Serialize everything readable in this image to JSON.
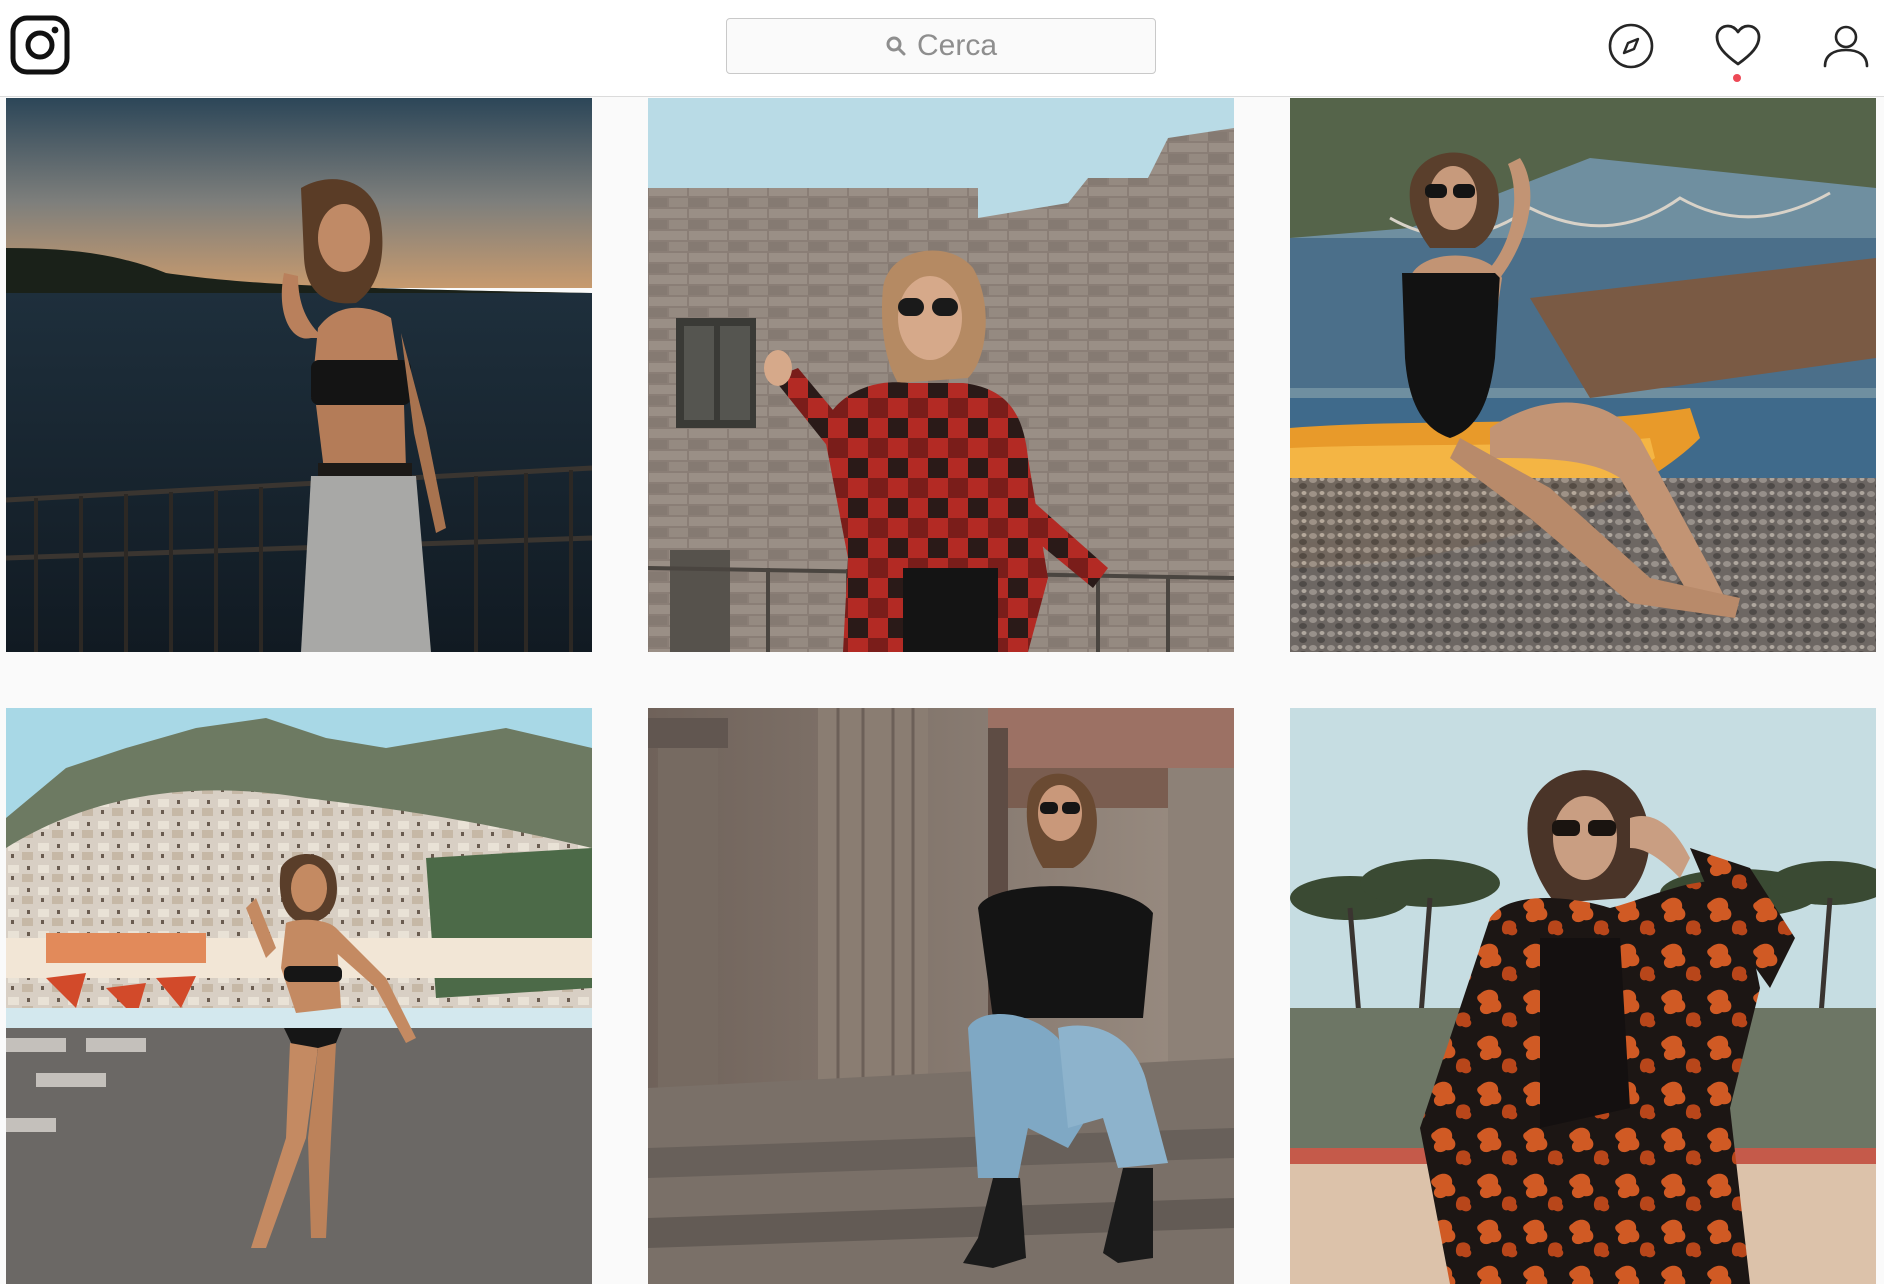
{
  "header": {
    "logo_icon": "instagram-logo-icon",
    "search": {
      "icon": "search-icon",
      "placeholder": "Cerca"
    },
    "nav_icons": [
      "compass-explore-icon",
      "heart-activity-icon",
      "user-profile-icon"
    ],
    "notification_dot_color": "#ed4956"
  },
  "grid": {
    "posts": [
      {
        "scene": "woman-crop-top-sunset-railing-sea"
      },
      {
        "scene": "woman-plaid-jacket-stone-building"
      },
      {
        "scene": "woman-black-swimsuit-yellow-kayak-pebble-beach"
      },
      {
        "scene": "woman-bikini-positano-beach"
      },
      {
        "scene": "woman-sitting-ancient-ruins-columns"
      },
      {
        "scene": "woman-floral-jacket-pine-trees"
      }
    ]
  }
}
